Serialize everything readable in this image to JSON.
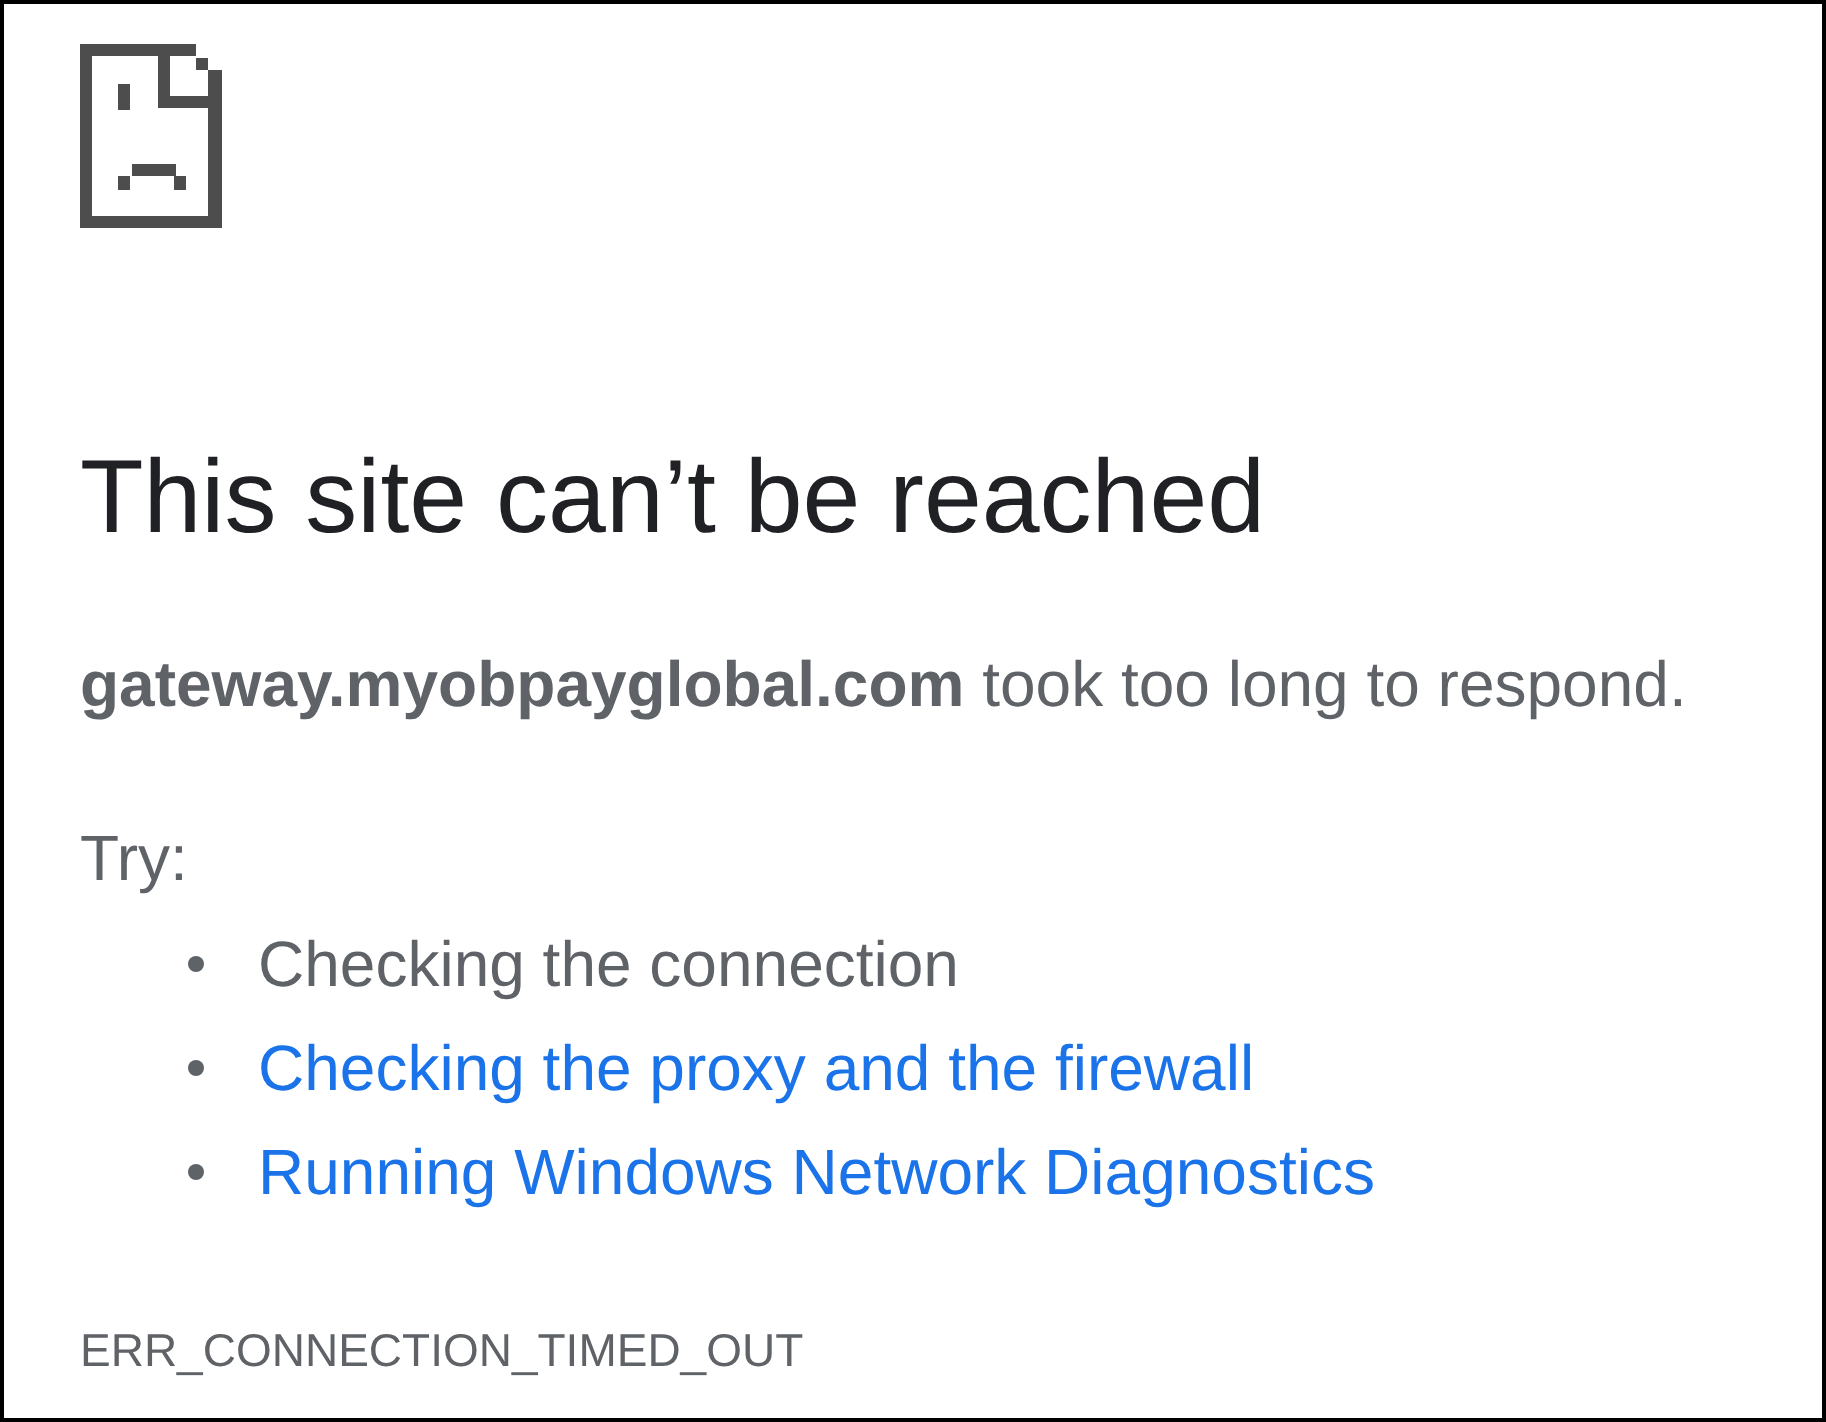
{
  "error_page": {
    "title": "This site can’t be reached",
    "message": "**gateway.myobpayglobal.com** took too long to respond.",
    "suggestions_label": "Try:",
    "suggestions": [
      {
        "kind": "text",
        "label": "Checking the connection"
      },
      {
        "kind": "link",
        "label": "Checking the proxy and the firewall"
      },
      {
        "kind": "link",
        "label": "Running Windows Network Diagnostics"
      }
    ],
    "error_code": "ERR_CONNECTION_TIMED_OUT"
  }
}
